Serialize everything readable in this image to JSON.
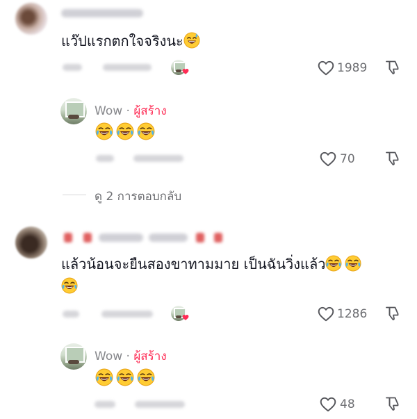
{
  "comments": [
    {
      "text": "แว๊ปแรกตกใจจริงนะ",
      "likes": "1989",
      "reply": {
        "author": "Wow",
        "separator": "·",
        "creator_label": "ผู้สร้าง",
        "likes": "70"
      },
      "view_replies": "ดู 2 การตอบกลับ"
    },
    {
      "text_line1": "แล้วน้อนจะยืนสองขาทามมาย เป็นฉันวิ่งแล้ว",
      "likes": "1286",
      "reply": {
        "author": "Wow",
        "separator": "·",
        "creator_label": "ผู้สร้าง",
        "likes": "48"
      }
    }
  ],
  "icons": {
    "like": "heart-outline-icon",
    "dislike": "thumbs-down-icon",
    "emoji_sweat": "grinning-sweat-emoji",
    "emoji_laugh": "tears-of-joy-emoji"
  },
  "colors": {
    "creator": "#fe2c55",
    "muted": "#86878b",
    "text": "#161823"
  }
}
